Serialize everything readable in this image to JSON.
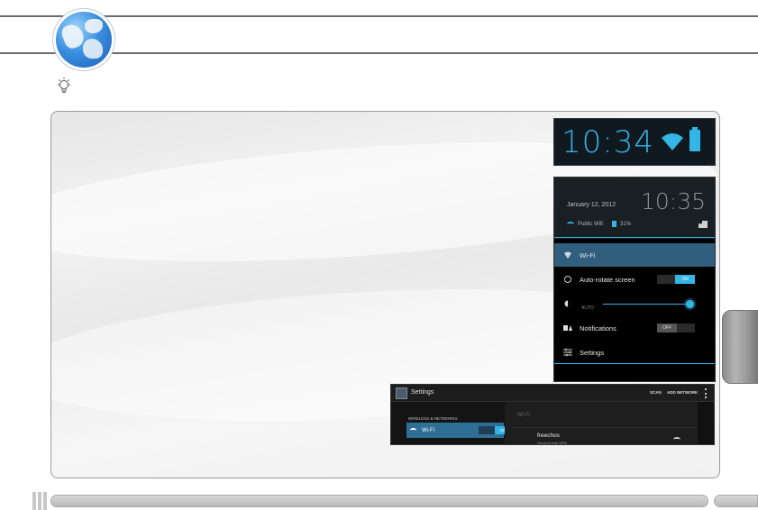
{
  "clock": {
    "time": "10:34"
  },
  "shade": {
    "date": "January 12, 2012",
    "time": "10:35",
    "network": "Public Wifi",
    "battery": "31%",
    "wifi_label": "Wi-Fi",
    "autorotate_label": "Auto-rotate screen",
    "autorotate_state": "ON",
    "brightness_auto": "AUTO",
    "notifications_label": "Notifications",
    "notifications_state": "OFF",
    "settings_label": "Settings"
  },
  "settings": {
    "title": "Settings",
    "scan": "SCAN",
    "add_network": "ADD NETWORK",
    "category": "WIRELESS & NETWORKS",
    "wifi_label": "Wi-Fi",
    "wifi_state": "ON",
    "right_header": "Wi-Fi",
    "network_name": "freechos",
    "network_security": "Secured with WPA"
  }
}
